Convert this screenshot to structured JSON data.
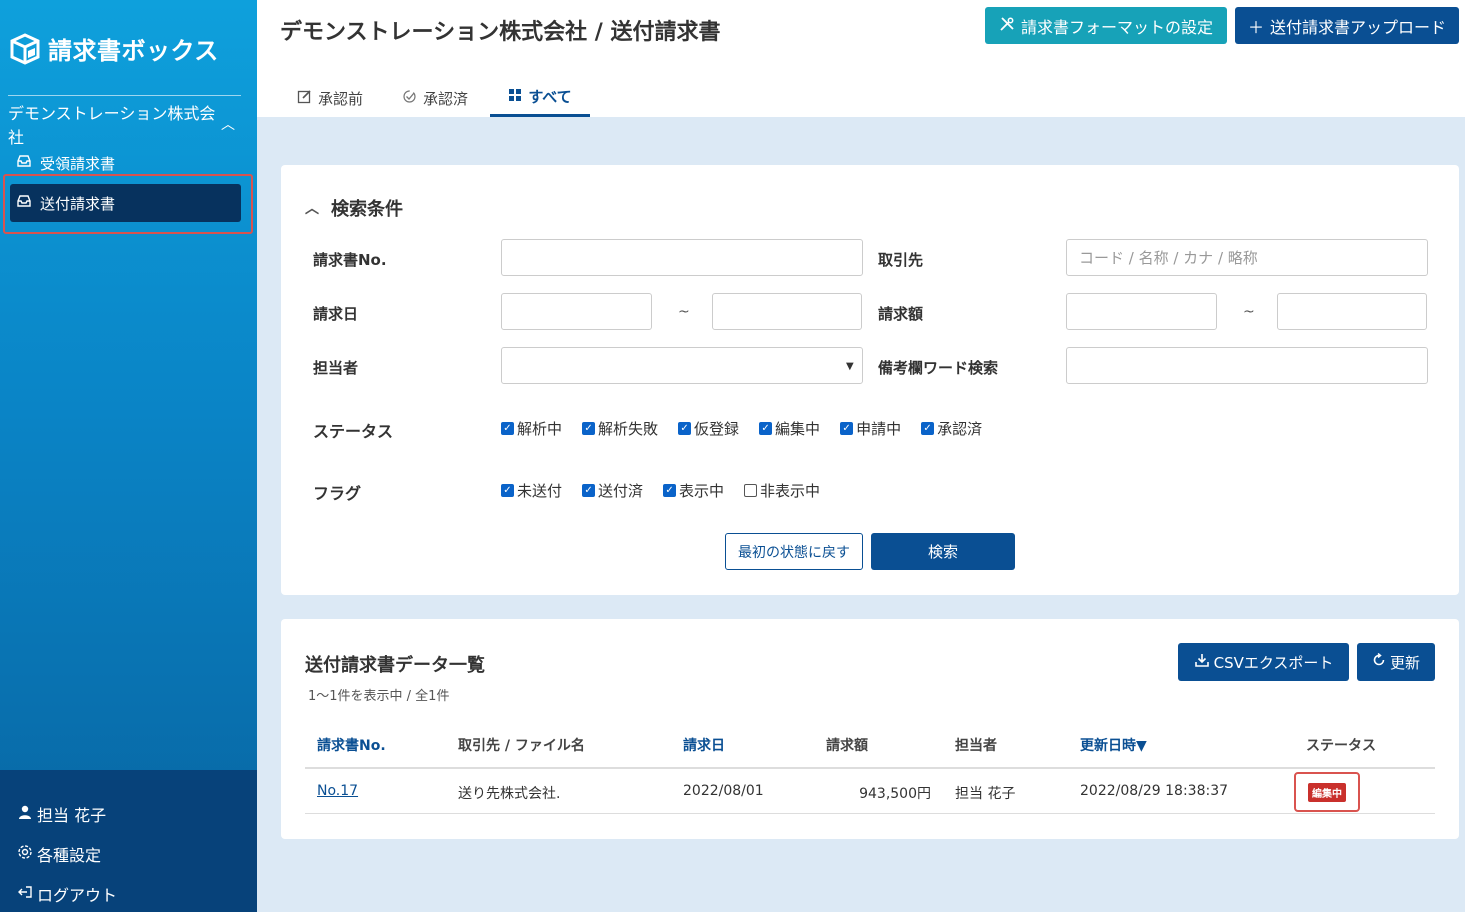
{
  "app": {
    "logo_text": "請求書ボックス",
    "company": "デモンストレーション株式会社",
    "nav": [
      {
        "label": "受領請求書"
      },
      {
        "label": "送付請求書"
      }
    ],
    "user_menu": {
      "user_name": "担当 花子",
      "settings": "各種設定",
      "logout": "ログアウト"
    }
  },
  "header": {
    "title": "デモンストレーション株式会社 / 送付請求書",
    "format_button": "請求書フォーマットの設定",
    "upload_button": "送付請求書アップロード",
    "tabs": [
      {
        "label": "承認前"
      },
      {
        "label": "承認済"
      },
      {
        "label": "すべて"
      }
    ]
  },
  "search": {
    "title": "検索条件",
    "labels": {
      "invoice_no": "請求書No.",
      "partner": "取引先",
      "invoice_date": "請求日",
      "amount": "請求額",
      "person": "担当者",
      "remarks": "備考欄ワード検索",
      "status": "ステータス",
      "flag": "フラグ"
    },
    "partner_placeholder": "コード / 名称 / カナ / 略称",
    "range_separator": "~",
    "status_options": [
      {
        "label": "解析中",
        "checked": true
      },
      {
        "label": "解析失敗",
        "checked": true
      },
      {
        "label": "仮登録",
        "checked": true
      },
      {
        "label": "編集中",
        "checked": true
      },
      {
        "label": "申請中",
        "checked": true
      },
      {
        "label": "承認済",
        "checked": true
      }
    ],
    "flag_options": [
      {
        "label": "未送付",
        "checked": true
      },
      {
        "label": "送付済",
        "checked": true
      },
      {
        "label": "表示中",
        "checked": true
      },
      {
        "label": "非表示中",
        "checked": false
      }
    ],
    "reset_button": "最初の状態に戻す",
    "search_button": "検索"
  },
  "results": {
    "title": "送付請求書データ一覧",
    "count_text": "1〜1件を表示中 / 全1件",
    "csv_button": "CSVエクスポート",
    "refresh_button": "更新",
    "columns": [
      "請求書No.",
      "取引先 / ファイル名",
      "請求日",
      "請求額",
      "担当者",
      "更新日時",
      "ステータス"
    ],
    "sort_indicator": "▼",
    "rows": [
      {
        "invoice_no": "No.17",
        "partner": "送り先株式会社.",
        "date": "2022/08/01",
        "amount": "943,500円",
        "person": "担当 花子",
        "updated": "2022/08/29 18:38:37",
        "status": "編集中"
      }
    ]
  },
  "colors": {
    "primary": "#0a4f93",
    "teal": "#17a2b8",
    "highlight": "#d9534f"
  }
}
